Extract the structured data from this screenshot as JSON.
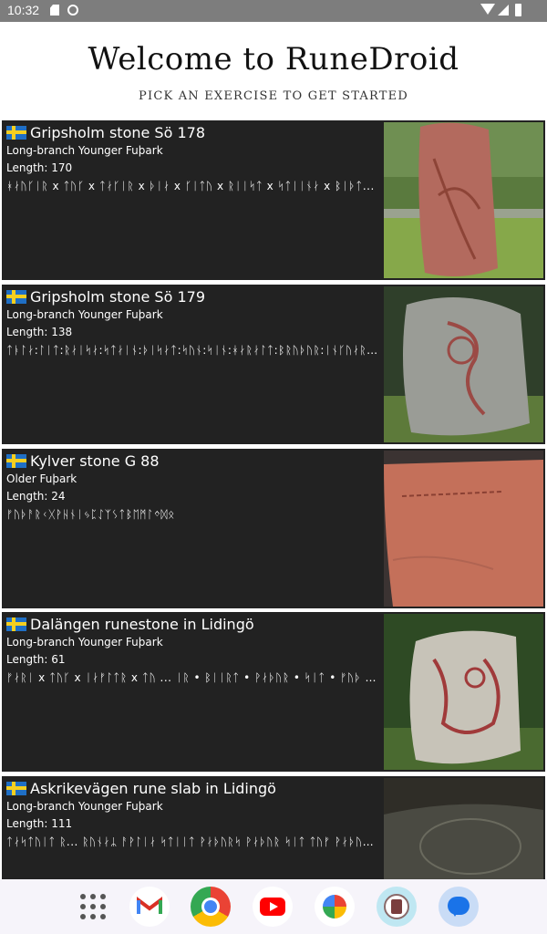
{
  "status_bar": {
    "time": "10:32"
  },
  "header": {
    "title": "Welcome to RuneDroid",
    "subtitle": "PICK AN EXERCISE TO GET STARTED"
  },
  "cards": [
    {
      "title": "Gripsholm stone Sö 178",
      "type": "Long-branch Younger Fuþark",
      "length": "Length: 170",
      "runes": "ᚼᛅᚢᚴᛁᚱ x ᛏᚢᚴ x ᛏᛅᚴᛁᚱ x ᚦᛁᛅ x ᚴᛁᛏᚢ x ᚱᛁᛁᛋᛏ x ᛋᛏᛁᛁᚾᛅ x ᛒᛁᚦᛏ..."
    },
    {
      "title": "Gripsholm stone Sö 179",
      "type": "Long-branch Younger Fuþark",
      "length": "Length: 138",
      "runes": "ᛏᚭᛚᛅ:ᛚᛁᛏ:ᚱᛅᛁᛋᛅ:ᛋᛏᛅᛁᚾ:ᚦᛁᛋᛅᛏ:ᛋᚢᚾ:ᛋᛁᚾ:ᚼᛅᚱᛅᛚᛏ:ᛒᚱᚢᚦᚢᚱ:ᛁᚾᚴᚢᛅᚱᛋ:ᚦᛅ..."
    },
    {
      "title": "Kylver stone G 88",
      "type": "Older Fuþark",
      "length": "Length: 24",
      "runes": "ᚠᚢᚦᚨᚱᚲᚷᚹᚺᚾᛁᛃᛈᛇᛉᛊᛏᛒᛖᛗᛚᛜᛞᛟ"
    },
    {
      "title": "Dalängen runestone in Lidingö",
      "type": "Long-branch Younger Fuþark",
      "length": "Length: 61",
      "runes": "ᚠᛅᚱᛁ x ᛏᚢᚴ x ᛁᛅᚠᛚᛏᚱ x ᛏᚢ ... ᛁᚱ • ᛒᛁᛁᚱᛏ • ᚹᛅᚦᚢᚱ • ᛋᛁᛏ • ᚠᚢᚦ • ..."
    },
    {
      "title": "Askrikevägen rune slab in Lidingö",
      "type": "Long-branch Younger Fuþark",
      "length": "Length: 111",
      "runes": "ᛏᛅᛋᛏᚢᛁᛏ ᚱ... ᚱᚢᚾᛅᛦ ᚨᚹᛚᛁᛅ ᛋᛏᛁᛁᛏ ᚹᛅᚦᚢᚱᛋ ᚹᛅᚦᚢᚱ ᛋᛁᛏ ᛏᚢᚠ ᚹᛅᚦᚢᚱ ᛋ..."
    }
  ],
  "dock": {
    "apps": [
      "app-drawer",
      "gmail",
      "chrome",
      "youtube",
      "photos",
      "runedroid",
      "messages"
    ]
  },
  "colors": {
    "status_bar": "#7d7d7d",
    "card_bg": "#222222",
    "dock_bg": "#f6f4fa"
  }
}
